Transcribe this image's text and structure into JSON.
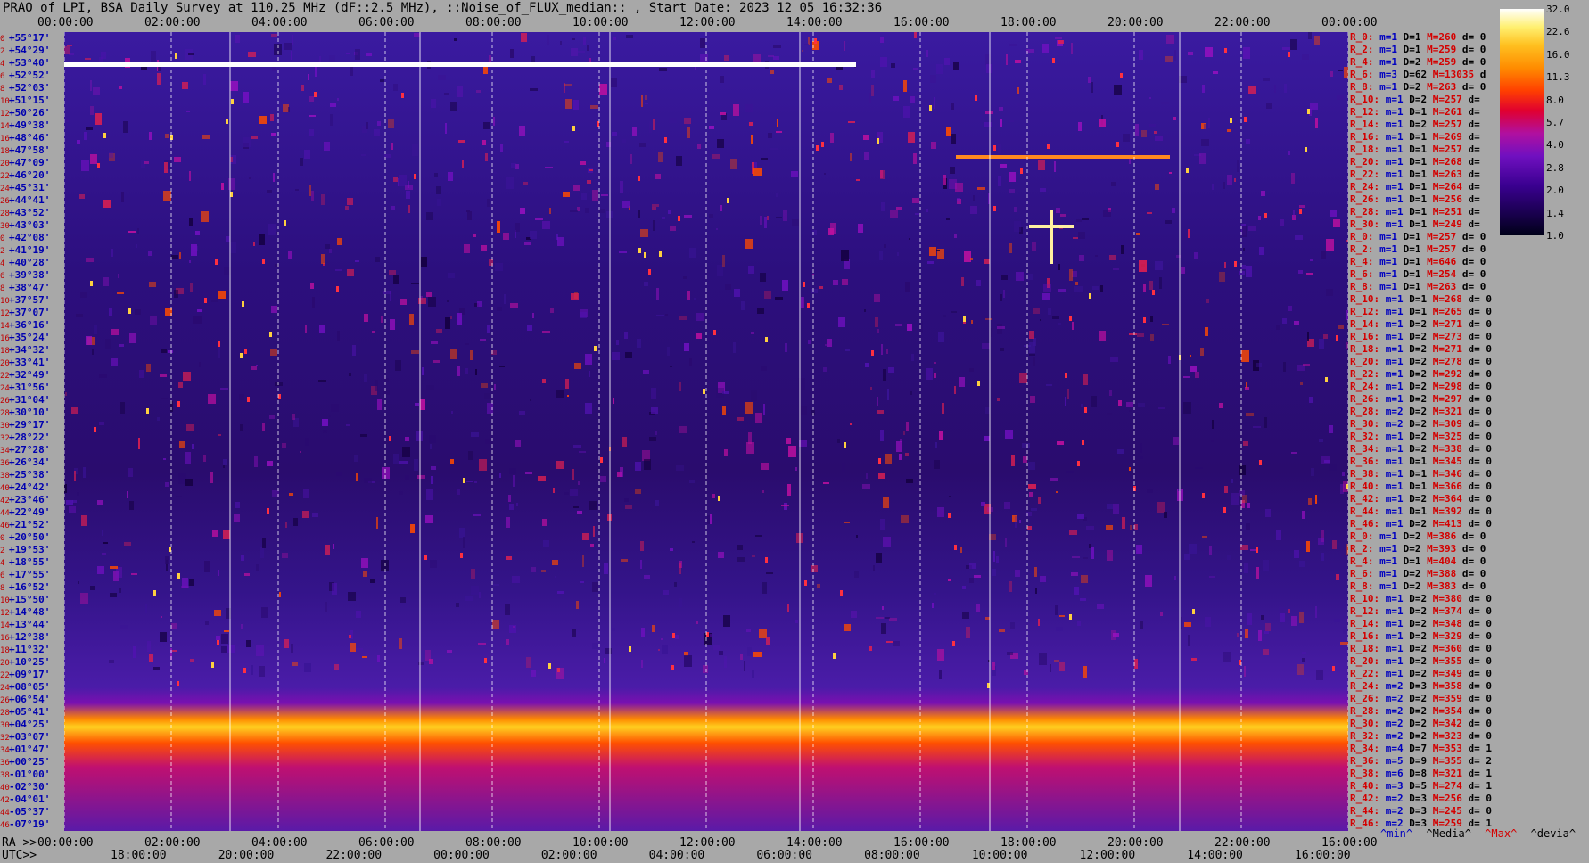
{
  "title": "PRAO of LPI, BSA Daily Survey at 110.25 MHz (dF::2.5 MHz), ::Noise_of_FLUX_median:: , Start Date: 2023 12 05 16:32:36",
  "chart_data": {
    "type": "heatmap",
    "top_ticks": [
      "00:00:00",
      "02:00:00",
      "04:00:00",
      "06:00:00",
      "08:00:00",
      "10:00:00",
      "12:00:00",
      "14:00:00",
      "16:00:00",
      "18:00:00",
      "20:00:00",
      "22:00:00",
      "00:00:00"
    ],
    "ra_label": "RA >>",
    "ra_ticks": [
      "00:00:00",
      "02:00:00",
      "04:00:00",
      "06:00:00",
      "08:00:00",
      "10:00:00",
      "12:00:00",
      "14:00:00",
      "16:00:00",
      "18:00:00",
      "20:00:00",
      "22:00:00",
      "16:00:00"
    ],
    "utc_label": "UTC>>",
    "utc_ticks": [
      "18:00:00",
      "20:00:00",
      "22:00:00",
      "00:00:00",
      "02:00:00",
      "04:00:00",
      "06:00:00",
      "08:00:00",
      "10:00:00",
      "12:00:00",
      "14:00:00",
      "16:00:00"
    ],
    "declinations": [
      "+55°17'",
      "+54°29'",
      "+53°40'",
      "+52°52'",
      "+52°03'",
      "+51°15'",
      "+50°26'",
      "+49°38'",
      "+48°46'",
      "+47°58'",
      "+47°09'",
      "+46°20'",
      "+45°31'",
      "+44°41'",
      "+43°52'",
      "+43°03'",
      "+42°08'",
      "+41°19'",
      "+40°28'",
      "+39°38'",
      "+38°47'",
      "+37°57'",
      "+37°07'",
      "+36°16'",
      "+35°24'",
      "+34°32'",
      "+33°41'",
      "+32°49'",
      "+31°56'",
      "+31°04'",
      "+30°10'",
      "+29°17'",
      "+28°22'",
      "+27°28'",
      "+26°34'",
      "+25°38'",
      "+24°42'",
      "+23°46'",
      "+22°49'",
      "+21°52'",
      "+20°50'",
      "+19°53'",
      "+18°55'",
      "+17°55'",
      "+16°52'",
      "+15°50'",
      "+14°48'",
      "+13°44'",
      "+12°38'",
      "+11°32'",
      "+10°25'",
      "+09°17'",
      "+08°05'",
      "+06°54'",
      "+05°41'",
      "+04°25'",
      "+03°07'",
      "+01°47'",
      "+00°25'",
      "-01°00'",
      "-02°30'",
      "-04°01'",
      "-05°37'",
      "-07°19'"
    ],
    "decl_index": [
      "0",
      "2",
      "4",
      "6",
      "8",
      "10",
      "12",
      "14",
      "16",
      "18",
      "20",
      "22",
      "24",
      "26",
      "28",
      "30",
      "0",
      "2",
      "4",
      "6",
      "8",
      "10",
      "12",
      "14",
      "16",
      "18",
      "20",
      "22",
      "24",
      "26",
      "28",
      "30",
      "32",
      "34",
      "36",
      "38",
      "40",
      "42",
      "44",
      "46",
      "0",
      "2",
      "4",
      "6",
      "8",
      "10",
      "12",
      "14",
      "16",
      "18",
      "20",
      "22",
      "24",
      "26",
      "28",
      "30",
      "32",
      "34",
      "36",
      "38",
      "40",
      "42",
      "44",
      "46"
    ],
    "stats": [
      {
        "r": "R_0:",
        "m": "m=1",
        "d": "D=1",
        "M": "M=260",
        "dv": "d= 0"
      },
      {
        "r": "R_2:",
        "m": "m=1",
        "d": "D=1",
        "M": "M=259",
        "dv": "d= 0"
      },
      {
        "r": "R_4:",
        "m": "m=1",
        "d": "D=2",
        "M": "M=259",
        "dv": "d= 0"
      },
      {
        "r": "R_6:",
        "m": "m=3",
        "d": "D=62",
        "M": "M=13035",
        "dv": "d"
      },
      {
        "r": "R_8:",
        "m": "m=1",
        "d": "D=2",
        "M": "M=263",
        "dv": "d= 0"
      },
      {
        "r": "R_10:",
        "m": "m=1",
        "d": "D=2",
        "M": "M=257",
        "dv": "d="
      },
      {
        "r": "R_12:",
        "m": "m=1",
        "d": "D=1",
        "M": "M=261",
        "dv": "d="
      },
      {
        "r": "R_14:",
        "m": "m=1",
        "d": "D=2",
        "M": "M=257",
        "dv": "d="
      },
      {
        "r": "R_16:",
        "m": "m=1",
        "d": "D=1",
        "M": "M=269",
        "dv": "d="
      },
      {
        "r": "R_18:",
        "m": "m=1",
        "d": "D=1",
        "M": "M=257",
        "dv": "d="
      },
      {
        "r": "R_20:",
        "m": "m=1",
        "d": "D=1",
        "M": "M=268",
        "dv": "d="
      },
      {
        "r": "R_22:",
        "m": "m=1",
        "d": "D=1",
        "M": "M=263",
        "dv": "d="
      },
      {
        "r": "R_24:",
        "m": "m=1",
        "d": "D=1",
        "M": "M=264",
        "dv": "d="
      },
      {
        "r": "R_26:",
        "m": "m=1",
        "d": "D=1",
        "M": "M=256",
        "dv": "d="
      },
      {
        "r": "R_28:",
        "m": "m=1",
        "d": "D=1",
        "M": "M=251",
        "dv": "d="
      },
      {
        "r": "R_30:",
        "m": "m=1",
        "d": "D=1",
        "M": "M=249",
        "dv": "d="
      },
      {
        "r": "R_0:",
        "m": "m=1",
        "d": "D=1",
        "M": "M=257",
        "dv": "d= 0"
      },
      {
        "r": "R_2:",
        "m": "m=1",
        "d": "D=1",
        "M": "M=257",
        "dv": "d= 0"
      },
      {
        "r": "R_4:",
        "m": "m=1",
        "d": "D=1",
        "M": "M=646",
        "dv": "d= 0"
      },
      {
        "r": "R_6:",
        "m": "m=1",
        "d": "D=1",
        "M": "M=254",
        "dv": "d= 0"
      },
      {
        "r": "R_8:",
        "m": "m=1",
        "d": "D=1",
        "M": "M=263",
        "dv": "d= 0"
      },
      {
        "r": "R_10:",
        "m": "m=1",
        "d": "D=1",
        "M": "M=268",
        "dv": "d= 0"
      },
      {
        "r": "R_12:",
        "m": "m=1",
        "d": "D=1",
        "M": "M=265",
        "dv": "d= 0"
      },
      {
        "r": "R_14:",
        "m": "m=1",
        "d": "D=2",
        "M": "M=271",
        "dv": "d= 0"
      },
      {
        "r": "R_16:",
        "m": "m=1",
        "d": "D=2",
        "M": "M=273",
        "dv": "d= 0"
      },
      {
        "r": "R_18:",
        "m": "m=1",
        "d": "D=2",
        "M": "M=271",
        "dv": "d= 0"
      },
      {
        "r": "R_20:",
        "m": "m=1",
        "d": "D=2",
        "M": "M=278",
        "dv": "d= 0"
      },
      {
        "r": "R_22:",
        "m": "m=1",
        "d": "D=2",
        "M": "M=292",
        "dv": "d= 0"
      },
      {
        "r": "R_24:",
        "m": "m=1",
        "d": "D=2",
        "M": "M=298",
        "dv": "d= 0"
      },
      {
        "r": "R_26:",
        "m": "m=1",
        "d": "D=2",
        "M": "M=297",
        "dv": "d= 0"
      },
      {
        "r": "R_28:",
        "m": "m=2",
        "d": "D=2",
        "M": "M=321",
        "dv": "d= 0"
      },
      {
        "r": "R_30:",
        "m": "m=2",
        "d": "D=2",
        "M": "M=309",
        "dv": "d= 0"
      },
      {
        "r": "R_32:",
        "m": "m=1",
        "d": "D=2",
        "M": "M=325",
        "dv": "d= 0"
      },
      {
        "r": "R_34:",
        "m": "m=1",
        "d": "D=2",
        "M": "M=338",
        "dv": "d= 0"
      },
      {
        "r": "R_36:",
        "m": "m=1",
        "d": "D=1",
        "M": "M=345",
        "dv": "d= 0"
      },
      {
        "r": "R_38:",
        "m": "m=1",
        "d": "D=1",
        "M": "M=346",
        "dv": "d= 0"
      },
      {
        "r": "R_40:",
        "m": "m=1",
        "d": "D=1",
        "M": "M=366",
        "dv": "d= 0"
      },
      {
        "r": "R_42:",
        "m": "m=1",
        "d": "D=2",
        "M": "M=364",
        "dv": "d= 0"
      },
      {
        "r": "R_44:",
        "m": "m=1",
        "d": "D=1",
        "M": "M=392",
        "dv": "d= 0"
      },
      {
        "r": "R_46:",
        "m": "m=1",
        "d": "D=2",
        "M": "M=413",
        "dv": "d= 0"
      },
      {
        "r": "R_0:",
        "m": "m=1",
        "d": "D=2",
        "M": "M=386",
        "dv": "d= 0"
      },
      {
        "r": "R_2:",
        "m": "m=1",
        "d": "D=2",
        "M": "M=393",
        "dv": "d= 0"
      },
      {
        "r": "R_4:",
        "m": "m=1",
        "d": "D=1",
        "M": "M=404",
        "dv": "d= 0"
      },
      {
        "r": "R_6:",
        "m": "m=1",
        "d": "D=2",
        "M": "M=388",
        "dv": "d= 0"
      },
      {
        "r": "R_8:",
        "m": "m=1",
        "d": "D=2",
        "M": "M=383",
        "dv": "d= 0"
      },
      {
        "r": "R_10:",
        "m": "m=1",
        "d": "D=2",
        "M": "M=380",
        "dv": "d= 0"
      },
      {
        "r": "R_12:",
        "m": "m=1",
        "d": "D=2",
        "M": "M=374",
        "dv": "d= 0"
      },
      {
        "r": "R_14:",
        "m": "m=1",
        "d": "D=2",
        "M": "M=348",
        "dv": "d= 0"
      },
      {
        "r": "R_16:",
        "m": "m=1",
        "d": "D=2",
        "M": "M=329",
        "dv": "d= 0"
      },
      {
        "r": "R_18:",
        "m": "m=1",
        "d": "D=2",
        "M": "M=360",
        "dv": "d= 0"
      },
      {
        "r": "R_20:",
        "m": "m=1",
        "d": "D=2",
        "M": "M=355",
        "dv": "d= 0"
      },
      {
        "r": "R_22:",
        "m": "m=1",
        "d": "D=2",
        "M": "M=349",
        "dv": "d= 0"
      },
      {
        "r": "R_24:",
        "m": "m=2",
        "d": "D=3",
        "M": "M=358",
        "dv": "d= 0"
      },
      {
        "r": "R_26:",
        "m": "m=2",
        "d": "D=2",
        "M": "M=359",
        "dv": "d= 0"
      },
      {
        "r": "R_28:",
        "m": "m=2",
        "d": "D=2",
        "M": "M=354",
        "dv": "d= 0"
      },
      {
        "r": "R_30:",
        "m": "m=2",
        "d": "D=2",
        "M": "M=342",
        "dv": "d= 0"
      },
      {
        "r": "R_32:",
        "m": "m=2",
        "d": "D=2",
        "M": "M=323",
        "dv": "d= 0"
      },
      {
        "r": "R_34:",
        "m": "m=4",
        "d": "D=7",
        "M": "M=353",
        "dv": "d= 1"
      },
      {
        "r": "R_36:",
        "m": "m=5",
        "d": "D=9",
        "M": "M=355",
        "dv": "d= 2"
      },
      {
        "r": "R_38:",
        "m": "m=6",
        "d": "D=8",
        "M": "M=321",
        "dv": "d= 1"
      },
      {
        "r": "R_40:",
        "m": "m=3",
        "d": "D=5",
        "M": "M=274",
        "dv": "d= 1"
      },
      {
        "r": "R_42:",
        "m": "m=2",
        "d": "D=3",
        "M": "M=256",
        "dv": "d= 0"
      },
      {
        "r": "R_44:",
        "m": "m=2",
        "d": "D=3",
        "M": "M=245",
        "dv": "d= 0"
      },
      {
        "r": "R_46:",
        "m": "m=2",
        "d": "D=3",
        "M": "M=259",
        "dv": "d= 1"
      }
    ],
    "colorbar": [
      "32.0",
      "22.6",
      "16.0",
      "11.3",
      "8.0",
      "5.7",
      "4.0",
      "2.8",
      "2.0",
      "1.4",
      "1.0"
    ],
    "legend": {
      "min": "^min^",
      "median": "^Media^",
      "max": "^Max^",
      "devia": "^devia^"
    },
    "colors": {
      "low": "#1a0050",
      "mid": "#7a10c0",
      "high": "#ff8c00",
      "peak": "#ffffff",
      "label_red": "#d40000",
      "label_blue": "#0000c0"
    }
  }
}
